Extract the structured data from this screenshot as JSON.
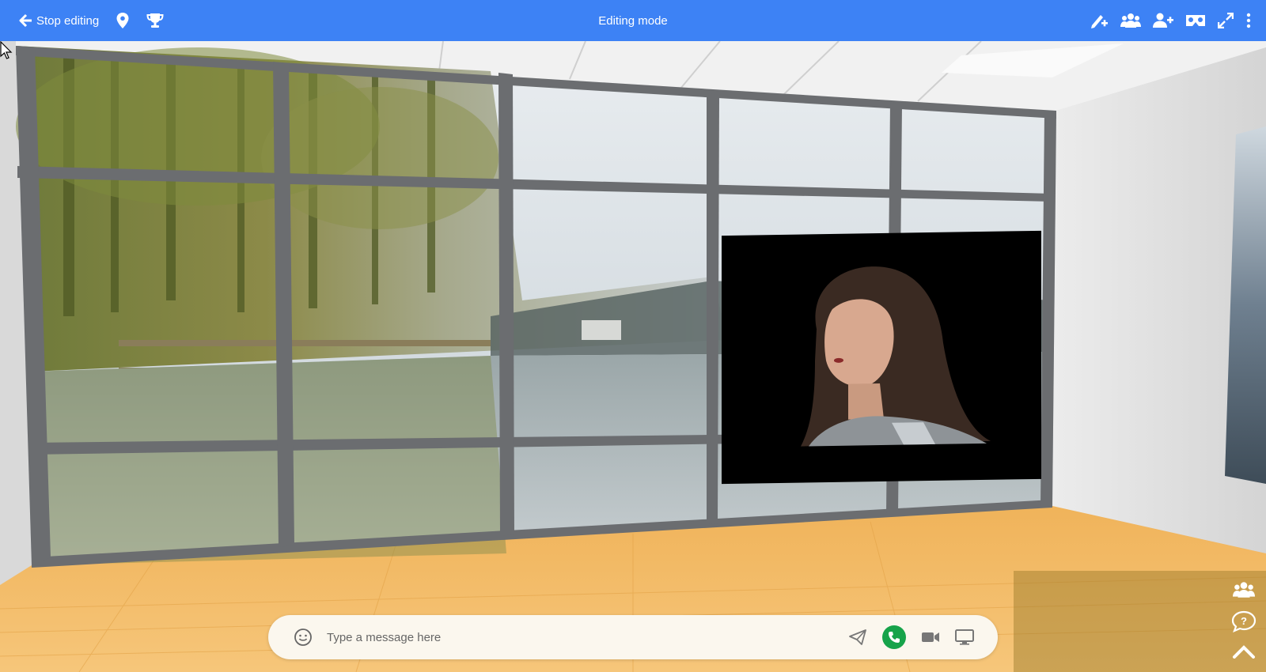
{
  "topbar": {
    "stop_label": "Stop editing",
    "title": "Editing mode",
    "left_icons": [
      "arrow-left-icon",
      "map-pin-icon",
      "trophy-icon"
    ],
    "right_icons": [
      "add-object-icon",
      "users-icon",
      "add-user-icon",
      "vr-headset-icon",
      "fullscreen-icon",
      "more-vertical-icon"
    ],
    "color": "#3d82f5"
  },
  "chat": {
    "placeholder": "Type a message here",
    "icons": [
      "emoji-icon",
      "send-icon",
      "phone-call-icon",
      "video-camera-icon",
      "screen-share-icon"
    ],
    "call_color": "#16a34a"
  },
  "side_panel": {
    "icons": [
      "users-icon",
      "help-chat-icon",
      "chevron-up-icon"
    ]
  },
  "scene": {
    "floor_color": "#f2b85d",
    "frame_color": "#6b6d70",
    "wall_color": "#e8e8e8"
  }
}
